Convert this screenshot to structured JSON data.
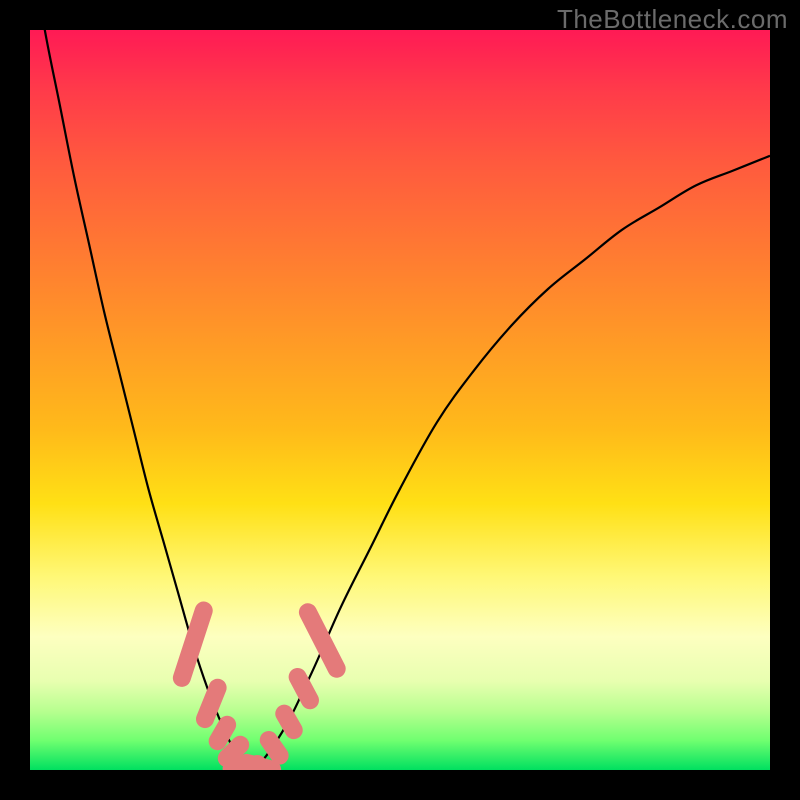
{
  "watermark": "TheBottleneck.com",
  "colors": {
    "marker": "#e47a7a",
    "curve": "#000000",
    "frame": "#000000"
  },
  "chart_data": {
    "type": "line",
    "title": "",
    "xlabel": "",
    "ylabel": "",
    "xlim": [
      0,
      100
    ],
    "ylim": [
      0,
      100
    ],
    "grid": false,
    "series": [
      {
        "name": "bottleneck-curve",
        "x": [
          0,
          2,
          4,
          6,
          8,
          10,
          12,
          14,
          16,
          18,
          20,
          22,
          24,
          26,
          28,
          30,
          34,
          38,
          42,
          46,
          50,
          55,
          60,
          65,
          70,
          75,
          80,
          85,
          90,
          95,
          100
        ],
        "values": [
          112,
          100,
          90,
          80,
          71,
          62,
          54,
          46,
          38,
          31,
          24,
          17,
          11,
          6,
          2,
          0,
          5,
          13,
          22,
          30,
          38,
          47,
          54,
          60,
          65,
          69,
          73,
          76,
          79,
          81,
          83
        ]
      }
    ],
    "markers": {
      "comment": "Pink sausage-shaped markers overlaid on the curve near the trough",
      "points": [
        {
          "x": 22,
          "y": 17,
          "len": 12,
          "angle": -72
        },
        {
          "x": 24.5,
          "y": 9,
          "len": 7,
          "angle": -68
        },
        {
          "x": 26,
          "y": 5,
          "len": 5,
          "angle": -60
        },
        {
          "x": 27.5,
          "y": 2.5,
          "len": 5,
          "angle": -45
        },
        {
          "x": 29,
          "y": 0.5,
          "len": 6,
          "angle": -10
        },
        {
          "x": 31,
          "y": 0.5,
          "len": 6,
          "angle": 15
        },
        {
          "x": 33,
          "y": 3,
          "len": 5,
          "angle": 55
        },
        {
          "x": 35,
          "y": 6.5,
          "len": 5,
          "angle": 60
        },
        {
          "x": 37,
          "y": 11,
          "len": 6,
          "angle": 62
        },
        {
          "x": 39.5,
          "y": 17.5,
          "len": 11,
          "angle": 63
        }
      ]
    }
  }
}
